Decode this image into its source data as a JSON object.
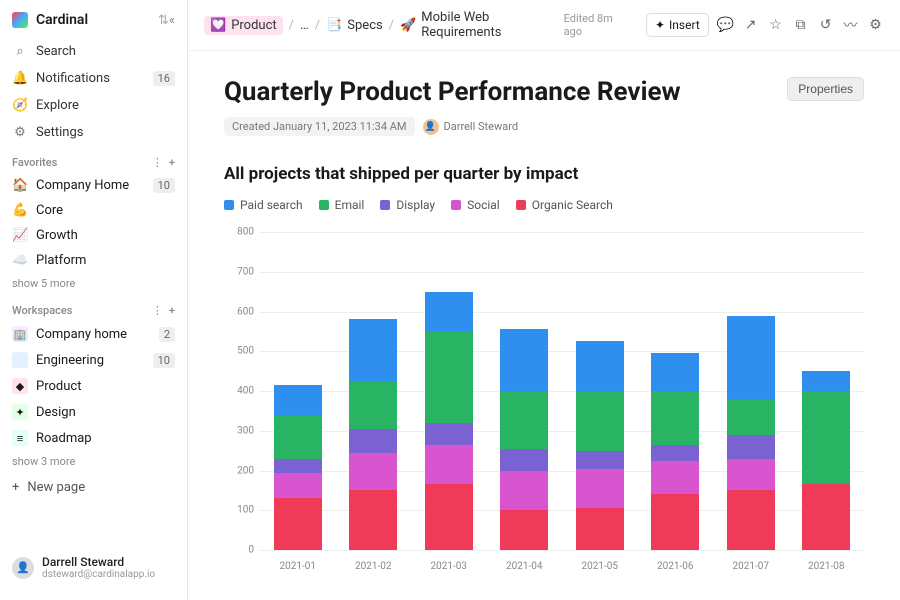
{
  "sidebar": {
    "workspace_name": "Cardinal",
    "nav": [
      {
        "icon": "⌕",
        "label": "Search"
      },
      {
        "icon": "🔔",
        "label": "Notifications",
        "badge": "16"
      },
      {
        "icon": "🧭",
        "label": "Explore"
      },
      {
        "icon": "⚙",
        "label": "Settings"
      }
    ],
    "favorites_label": "Favorites",
    "favorites": [
      {
        "emoji": "🏠",
        "label": "Company Home",
        "badge": "10"
      },
      {
        "emoji": "💪",
        "label": "Core"
      },
      {
        "emoji": "📈",
        "label": "Growth"
      },
      {
        "emoji": "☁️",
        "label": "Platform"
      }
    ],
    "show_more_fav": "show 5 more",
    "workspaces_label": "Workspaces",
    "workspaces": [
      {
        "icon": "🏢",
        "bg": "#f3eaff",
        "label": "Company home",
        "badge": "2"
      },
      {
        "icon": "</>",
        "bg": "#e2f1ff",
        "label": "Engineering",
        "badge": "10"
      },
      {
        "icon": "◆",
        "bg": "#ffe2ef",
        "label": "Product"
      },
      {
        "icon": "✦",
        "bg": "#e2ffe8",
        "label": "Design"
      },
      {
        "icon": "≡",
        "bg": "#e2fff5",
        "label": "Roadmap"
      }
    ],
    "show_more_ws": "show 3 more",
    "new_page_label": "New page",
    "user_name": "Darrell Steward",
    "user_email": "dsteward@cardinalapp.io"
  },
  "topbar": {
    "crumbs": [
      {
        "emoji": "💟",
        "label": "Product"
      },
      {
        "label": "…"
      },
      {
        "emoji": "📑",
        "label": "Specs"
      },
      {
        "emoji": "🚀",
        "label": "Mobile Web Requirements"
      }
    ],
    "edited": "Edited 8m ago",
    "insert_label": "Insert"
  },
  "page": {
    "title": "Quarterly Product Performance Review",
    "properties_label": "Properties",
    "created_meta": "Created January 11, 2023 11:34 AM",
    "author": "Darrell Steward"
  },
  "chart_data": {
    "type": "bar",
    "title": "All projects that shipped per quarter by impact",
    "ylim": [
      0,
      800
    ],
    "y_ticks": [
      0,
      100,
      200,
      300,
      400,
      500,
      600,
      700,
      800
    ],
    "categories": [
      "2021-01",
      "2021-02",
      "2021-03",
      "2021-04",
      "2021-05",
      "2021-06",
      "2021-07",
      "2021-08"
    ],
    "series": [
      {
        "name": "Paid search",
        "color": "#2f8fef",
        "values": [
          75,
          155,
          100,
          155,
          125,
          95,
          210,
          50
        ]
      },
      {
        "name": "Email",
        "color": "#28b463",
        "values": [
          110,
          120,
          230,
          145,
          150,
          135,
          90,
          235
        ]
      },
      {
        "name": "Display",
        "color": "#7b62d3",
        "values": [
          35,
          60,
          55,
          55,
          45,
          40,
          60,
          0
        ]
      },
      {
        "name": "Social",
        "color": "#d955d0",
        "values": [
          65,
          95,
          100,
          100,
          100,
          85,
          80,
          0
        ]
      },
      {
        "name": "Organic Search",
        "color": "#ef3b57",
        "values": [
          130,
          150,
          165,
          100,
          105,
          140,
          150,
          165
        ]
      }
    ]
  }
}
